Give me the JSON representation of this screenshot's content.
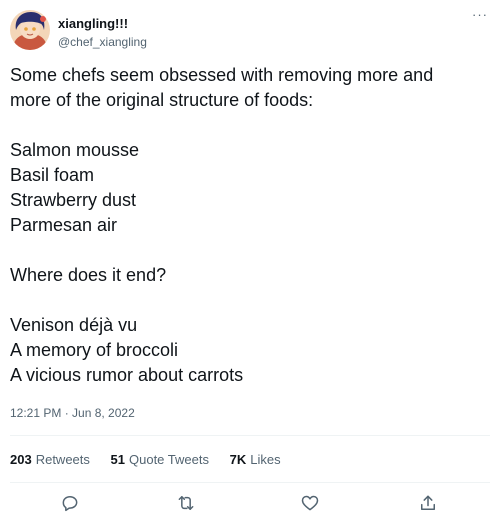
{
  "author": {
    "display_name": "xiangling!!!",
    "handle": "@chef_xiangling",
    "avatar": "anime-avatar"
  },
  "menu": {
    "icon": "more-options-icon",
    "label": "···"
  },
  "tweet": {
    "lines": [
      "Some chefs seem obsessed with removing more and",
      "more of the original structure of foods:",
      "",
      "Salmon mousse",
      "Basil foam",
      "Strawberry dust",
      "Parmesan air",
      "",
      "Where does it end?",
      "",
      "Venison déjà vu",
      "A memory of broccoli",
      "A vicious rumor about carrots"
    ],
    "timestamp": "12:21 PM · Jun 8, 2022"
  },
  "stats": {
    "retweets": {
      "count": "203",
      "label": "Retweets"
    },
    "quote_tweets": {
      "count": "51",
      "label": "Quote Tweets"
    },
    "likes": {
      "count": "7K",
      "label": "Likes"
    }
  },
  "actions": [
    "reply-icon",
    "retweet-icon",
    "like-icon",
    "share-icon"
  ],
  "colors": {
    "text": "#0f1419",
    "secondary": "#536471",
    "divider": "#eff3f4"
  }
}
